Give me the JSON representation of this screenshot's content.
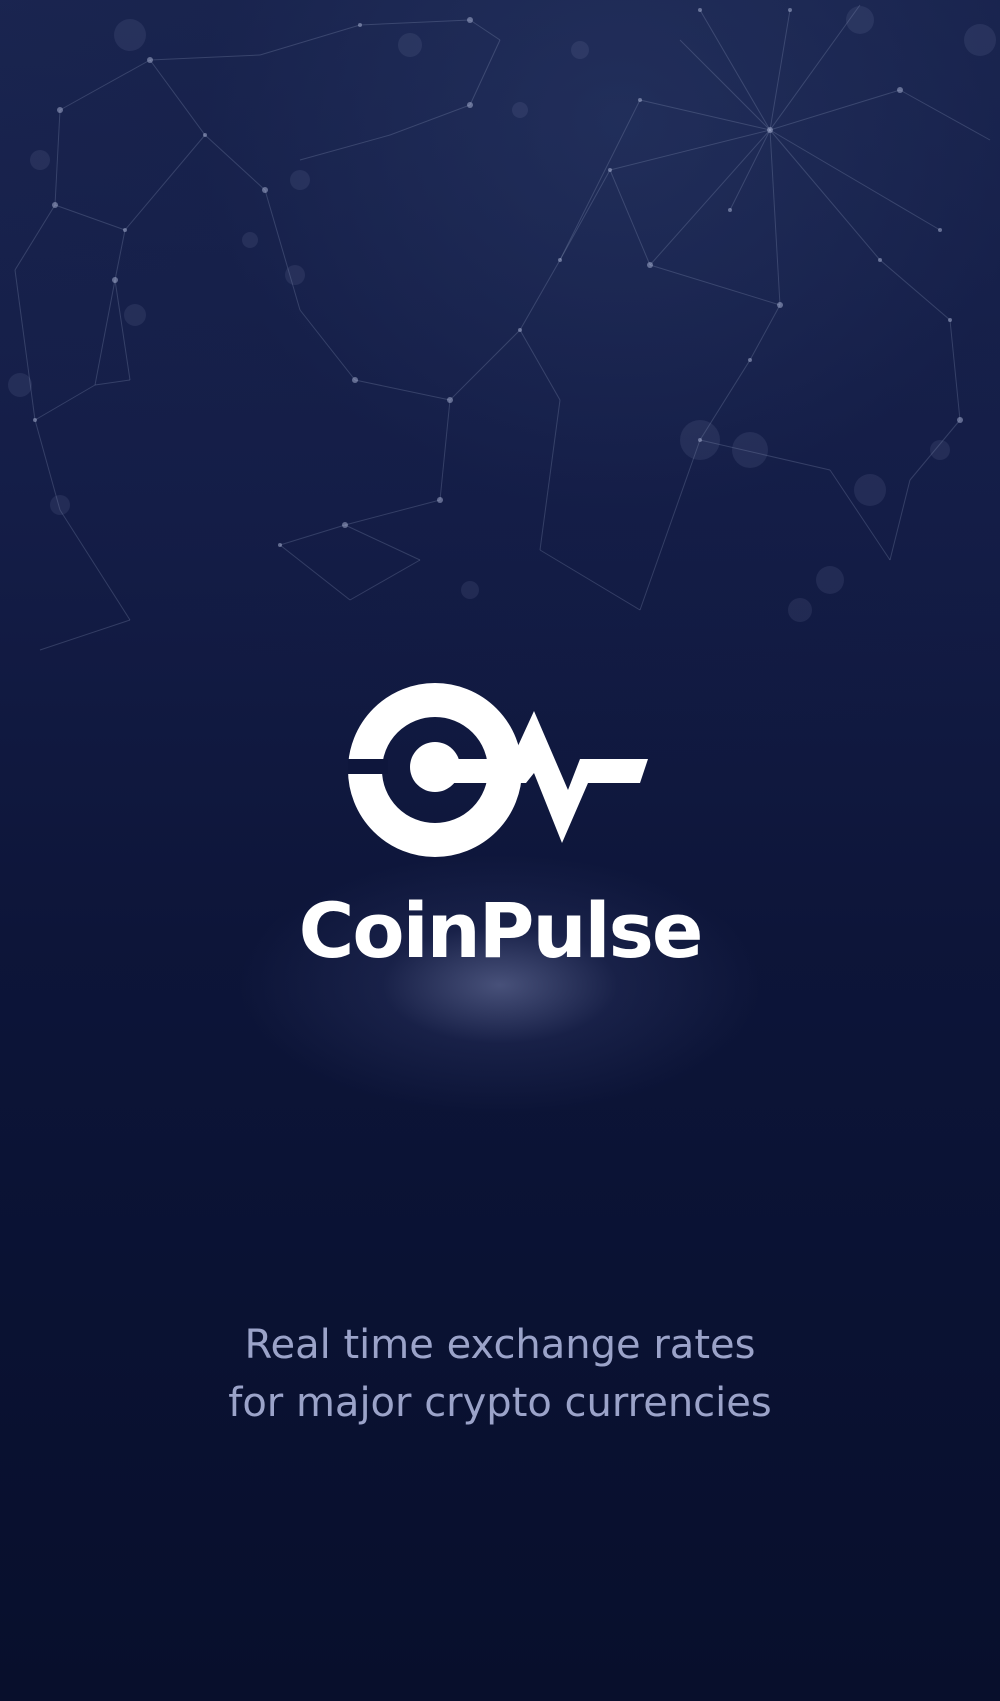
{
  "splash": {
    "brand_name": "CoinPulse",
    "tagline_line1": "Real time exchange rates",
    "tagline_line2": "for major crypto currencies",
    "logo_icon": "coin-pulse-logo-icon",
    "background_decoration": "network-constellation-graphic"
  },
  "colors": {
    "background": "#0b1233",
    "brand_text": "#ffffff",
    "tagline_text": "#9ba3c9"
  }
}
